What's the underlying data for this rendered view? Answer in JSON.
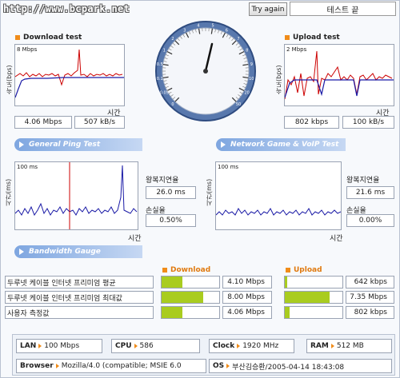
{
  "url": "http://www.bcpark.net",
  "toolbar": {
    "try_again": "Try again",
    "status": "테스트 끝"
  },
  "download": {
    "title": "Download test",
    "axis": "속도(bps)",
    "max_label": "8 Mbps",
    "time_label": "시간",
    "mbps": "4.06 Mbps",
    "kbs": "507 kB/s"
  },
  "upload": {
    "title": "Upload test",
    "axis": "속도(bps)",
    "max_label": "2 Mbps",
    "time_label": "시간",
    "kbps": "802 kbps",
    "kbs": "100 kB/s"
  },
  "speedometer": {
    "ticks": [
      "0",
      "0.05",
      "0.1",
      "0.5",
      "1",
      "2",
      "3",
      "4",
      "5",
      "6",
      "7",
      "8",
      "9",
      "10",
      "20",
      "50"
    ],
    "needle_value": "4.06 Mbps"
  },
  "ping": {
    "bar": "General Ping Test",
    "axis": "시간(ms)",
    "max_label": "100 ms",
    "time_label": "시간",
    "rtt_label": "왕복지연율",
    "rtt": "26.0 ms",
    "loss_label": "손실율",
    "loss": "0.50%"
  },
  "game": {
    "bar": "Network Game & VoIP Test",
    "axis": "시간(ms)",
    "max_label": "100 ms",
    "time_label": "시간",
    "rtt_label": "왕복지연율",
    "rtt": "21.6 ms",
    "loss_label": "손실율",
    "loss": "0.00%"
  },
  "bandwidth": {
    "bar": "Bandwidth Gauge",
    "download_header": "Download",
    "upload_header": "Upload",
    "rows": [
      {
        "label": "두루넷 케이블 인터넷 프리미엄 평균",
        "down": "4.10 Mbps",
        "down_frac": 0.36,
        "up": "642 kbps",
        "up_frac": 0.04
      },
      {
        "label": "두루넷 케이블 인터넷 프리미엄 최대값",
        "down": "8.00 Mbps",
        "down_frac": 0.72,
        "up": "7.35 Mbps",
        "up_frac": 0.78
      },
      {
        "label": "사용자 측정값",
        "down": "4.06 Mbps",
        "down_frac": 0.36,
        "up": "802 kbps",
        "up_frac": 0.08
      }
    ]
  },
  "system": {
    "lan_label": "LAN",
    "lan": "100 Mbps",
    "cpu_label": "CPU",
    "cpu": "586",
    "clock_label": "Clock",
    "clock": "1920 MHz",
    "ram_label": "RAM",
    "ram": "512 MB",
    "browser_label": "Browser",
    "browser": "Mozilla/4.0 (compatible; MSIE 6.0",
    "os_label": "OS",
    "os": "부산김승환/2005-04-14 18:43:08"
  },
  "colors": {
    "accent": "#f08c1a",
    "gauge": "#a9cc1f",
    "bar_blue": "#7ea6e0",
    "trace_red": "#cc0000",
    "trace_blue": "#1a1aa6"
  }
}
